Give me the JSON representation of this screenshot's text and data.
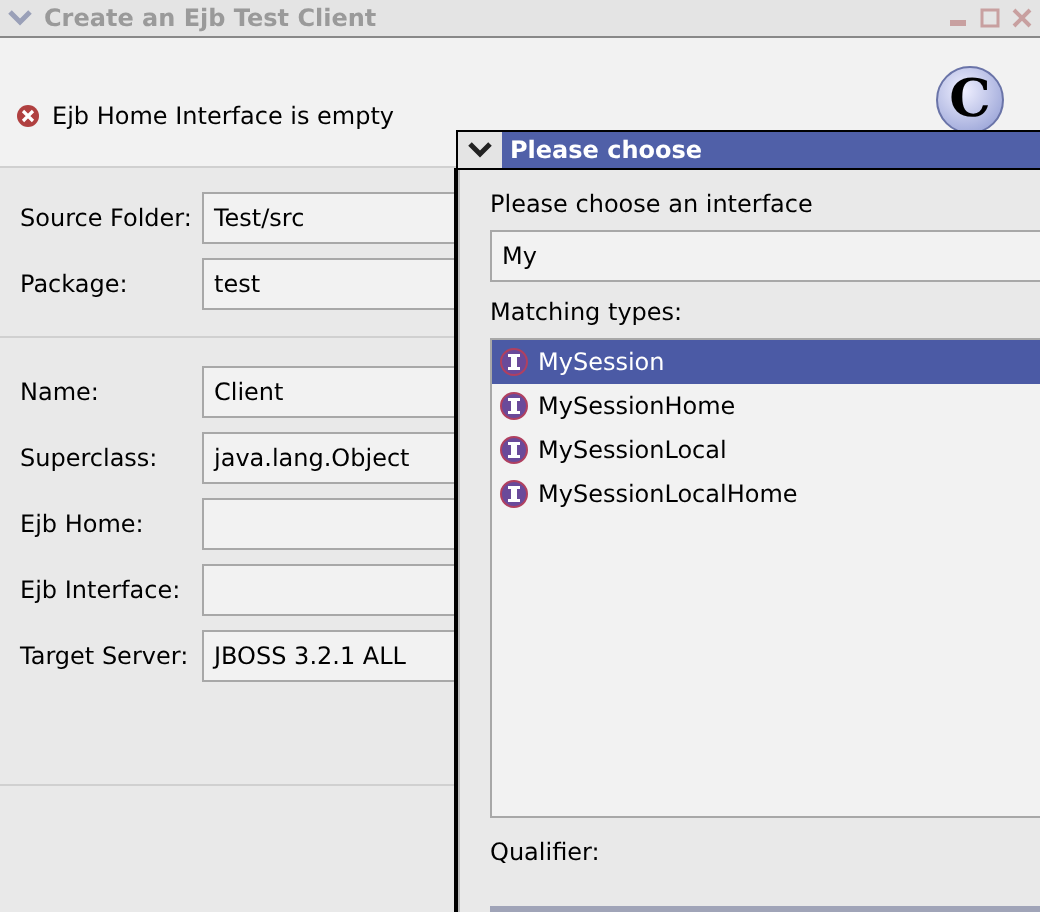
{
  "window": {
    "title": "Create an Ejb Test Client"
  },
  "message": {
    "kind": "error",
    "text": "Ejb Home Interface is empty"
  },
  "logo": {
    "letter": "C"
  },
  "form_top": [
    {
      "label": "Source Folder:",
      "value": "Test/src"
    },
    {
      "label": "Package:",
      "value": "test"
    }
  ],
  "form_bottom": [
    {
      "label": "Name:",
      "value": "Client"
    },
    {
      "label": "Superclass:",
      "value": "java.lang.Object"
    },
    {
      "label": "Ejb Home:"
    },
    {
      "label": "Ejb Interface:"
    },
    {
      "label": "Target Server:",
      "value": "JBOSS 3.2.1 ALL"
    }
  ],
  "dialog": {
    "title": "Please choose",
    "prompt": "Please choose an interface",
    "filter": "My",
    "list_label": "Matching types:",
    "items": [
      {
        "label": "MySession",
        "selected": true
      },
      {
        "label": "MySessionHome",
        "selected": false
      },
      {
        "label": "MySessionLocal",
        "selected": false
      },
      {
        "label": "MySessionLocalHome",
        "selected": false
      }
    ],
    "qualifier_label": "Qualifier:"
  }
}
